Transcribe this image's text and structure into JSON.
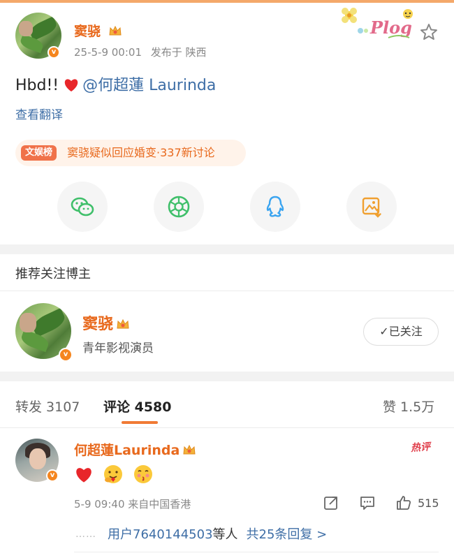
{
  "post": {
    "author": "窦骁",
    "date": "25-5-9 00:01",
    "published_from": "发布于 陕西",
    "text_prefix": "Hbd!!",
    "mention": "@何超蓮 Laurinda",
    "translate": "查看翻译",
    "sticker": "Plog",
    "hot": {
      "badge": "文娱榜",
      "text": "窦骁疑似回应婚变·337新讨论"
    },
    "share_targets": [
      {
        "name": "wechat-icon",
        "color": "#3fbf6a"
      },
      {
        "name": "moments-icon",
        "color": "#3fbf6a"
      },
      {
        "name": "qq-icon",
        "color": "#3aa4f0"
      },
      {
        "name": "save-image-icon",
        "color": "#f0a030"
      }
    ]
  },
  "recommend": {
    "title": "推荐关注博主",
    "name": "窦骁",
    "desc": "青年影视演员",
    "follow_label": "已关注"
  },
  "tabs": {
    "repost": "转发 3107",
    "comment": "评论 4580",
    "like": "赞 1.5万"
  },
  "comment": {
    "name": "何超蓮Laurinda",
    "hot_tag": "热评",
    "emojis": [
      "heart",
      "hug-emoji",
      "kiss-emoji"
    ],
    "date": "5-9 09:40",
    "source": "来自中国香港",
    "likes": "515",
    "reply_users": "用户7640144503",
    "reply_suffix": "等人",
    "reply_more": "共25条回复 >"
  },
  "colors": {
    "accent_orange": "#e8691d",
    "link_blue": "#3e6ea6",
    "verify": "#f5861f"
  }
}
